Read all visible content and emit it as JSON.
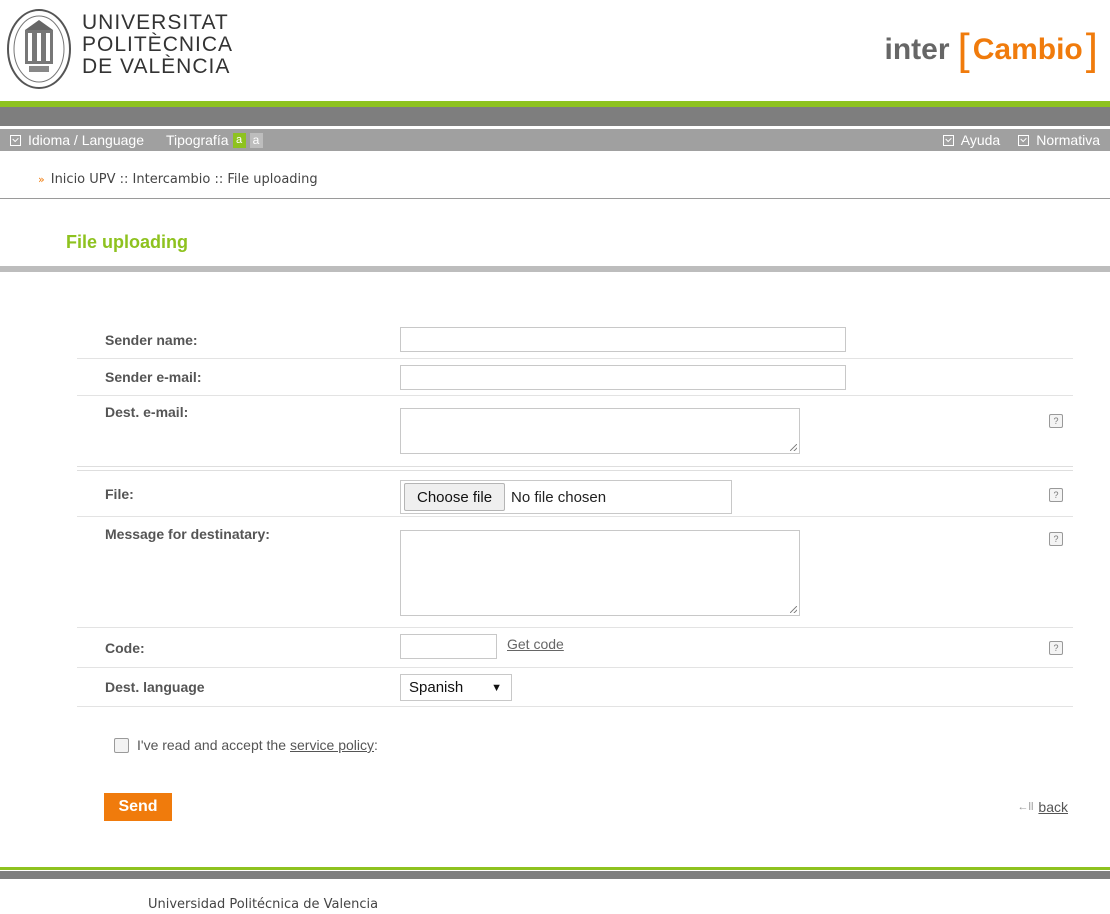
{
  "header": {
    "university_lines": [
      "UNIVERSITAT",
      "POLITÈCNICA",
      "DE VALÈNCIA"
    ],
    "brand_left": "inter",
    "brand_right": "Cambio"
  },
  "nav": {
    "language": "Idioma / Language",
    "typography": "Tipografía",
    "typo_small": "a",
    "typo_large": "a",
    "help": "Ayuda",
    "rules": "Normativa"
  },
  "breadcrumb": {
    "arrow": "»",
    "text": "Inicio UPV :: Intercambio :: File uploading"
  },
  "page_title": "File uploading",
  "form": {
    "sender_name_label": "Sender name:",
    "sender_name_value": "",
    "sender_email_label": "Sender e-mail:",
    "sender_email_value": "",
    "dest_email_label": "Dest. e-mail:",
    "dest_email_value": "",
    "file_label": "File:",
    "choose_file": "Choose file",
    "file_status": "No file chosen",
    "message_label": "Message for destinatary:",
    "message_value": "",
    "code_label": "Code:",
    "code_value": "",
    "get_code": "Get code",
    "language_label": "Dest. language",
    "language_value": "Spanish",
    "help_glyph": "?"
  },
  "policy": {
    "prefix": "I've read and accept the",
    "link": "service policy",
    "suffix": ":"
  },
  "actions": {
    "send": "Send",
    "back_icon": "←ll",
    "back": "back"
  },
  "footer": {
    "text": "Universidad Politécnica de Valencia"
  },
  "colors": {
    "accent_green": "#8ec21f",
    "accent_orange": "#f07b0c",
    "bar_gray": "#7e7e7e"
  }
}
